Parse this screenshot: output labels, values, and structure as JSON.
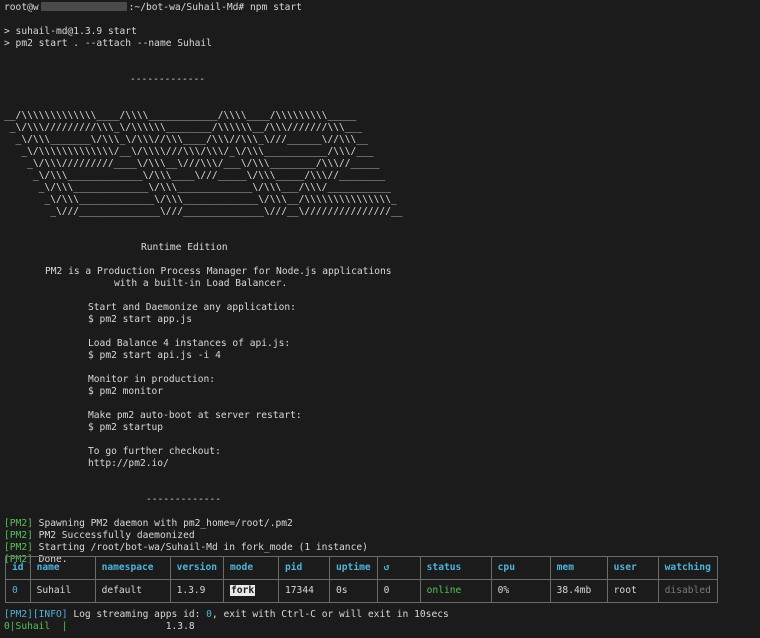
{
  "prompt": {
    "user_host_prefix": "root@w",
    "path_suffix": ":~/bot-wa/Suhail-Md#",
    "command": "npm start"
  },
  "npm": {
    "line1": "> suhail-md@1.3.9 start",
    "line2": "> pm2 start . --attach --name Suhail"
  },
  "banner": {
    "separator": "-------------",
    "ascii": [
      "__/\\\\\\\\\\\\\\\\\\\\\\\\\\____/\\\\\\\\____________/\\\\\\\\____/\\\\\\\\\\\\\\\\\\_____",
      " _\\/\\\\\\/////////\\\\\\_\\/\\\\\\\\\\\\________/\\\\\\\\\\\\__/\\\\\\///////\\\\\\___",
      "  _\\/\\\\\\_______\\/\\\\\\_\\/\\\\\\//\\\\\\____/\\\\\\//\\\\\\_\\///______\\//\\\\\\__",
      "   _\\/\\\\\\\\\\\\\\\\\\\\\\\\\\/__\\/\\\\\\\\///\\\\\\/\\\\\\/_\\/\\\\\\___________/\\\\\\/___",
      "    _\\/\\\\\\/////////____\\/\\\\\\__\\///\\\\\\/___\\/\\\\\\________/\\\\\\//_____",
      "     _\\/\\\\\\_____________\\/\\\\\\____\\///_____\\/\\\\\\_____/\\\\\\//________",
      "      _\\/\\\\\\_____________\\/\\\\\\_____________\\/\\\\\\___/\\\\\\/___________",
      "       _\\/\\\\\\_____________\\/\\\\\\_____________\\/\\\\\\__/\\\\\\\\\\\\\\\\\\\\\\\\\\\\\\_",
      "        _\\///______________\\///______________\\///__\\///////////////__"
    ],
    "edition": "Runtime Edition",
    "desc1": "PM2 is a Production Process Manager for Node.js applications",
    "desc2": "with a built-in Load Balancer.",
    "s1a": "Start and Daemonize any application:",
    "s1b": "$ pm2 start app.js",
    "s2a": "Load Balance 4 instances of api.js:",
    "s2b": "$ pm2 start api.js -i 4",
    "s3a": "Monitor in production:",
    "s3b": "$ pm2 monitor",
    "s4a": "Make pm2 auto-boot at server restart:",
    "s4b": "$ pm2 startup",
    "s5a": "To go further checkout:",
    "s5b": "http://pm2.io/"
  },
  "logs": [
    {
      "tag": "[PM2]",
      "text": " Spawning PM2 daemon with pm2_home=/root/.pm2"
    },
    {
      "tag": "[PM2]",
      "text": " PM2 Successfully daemonized"
    },
    {
      "tag": "[PM2]",
      "text": " Starting /root/bot-wa/Suhail-Md in fork_mode (1 instance)"
    },
    {
      "tag": "[PM2]",
      "text": " Done."
    }
  ],
  "table": {
    "headers": [
      "id",
      "name",
      "namespace",
      "version",
      "mode",
      "pid",
      "uptime",
      "↺",
      "status",
      "cpu",
      "mem",
      "user",
      "watching"
    ],
    "row": {
      "id": "0",
      "name": "Suhail",
      "namespace": "default",
      "version": "1.3.9",
      "mode": "fork",
      "pid": "17344",
      "uptime": "0s",
      "restarts": "0",
      "status": "online",
      "cpu": "0%",
      "mem": "38.4mb",
      "user": "root",
      "watching": "disabled"
    }
  },
  "tail": {
    "tag": "[PM2][INFO]",
    "text1": " Log streaming apps id: ",
    "app_id": "0",
    "text2": ", exit with Ctrl-C or will exit in 10secs",
    "stream_prefix": "0|Suhail",
    "stream_sep": "  |",
    "stream_text": "                 1.3.8"
  },
  "colors": {
    "background": "#1b1b1b",
    "text": "#d8d8d8",
    "green": "#58c058",
    "cyan": "#4fb3d9"
  }
}
